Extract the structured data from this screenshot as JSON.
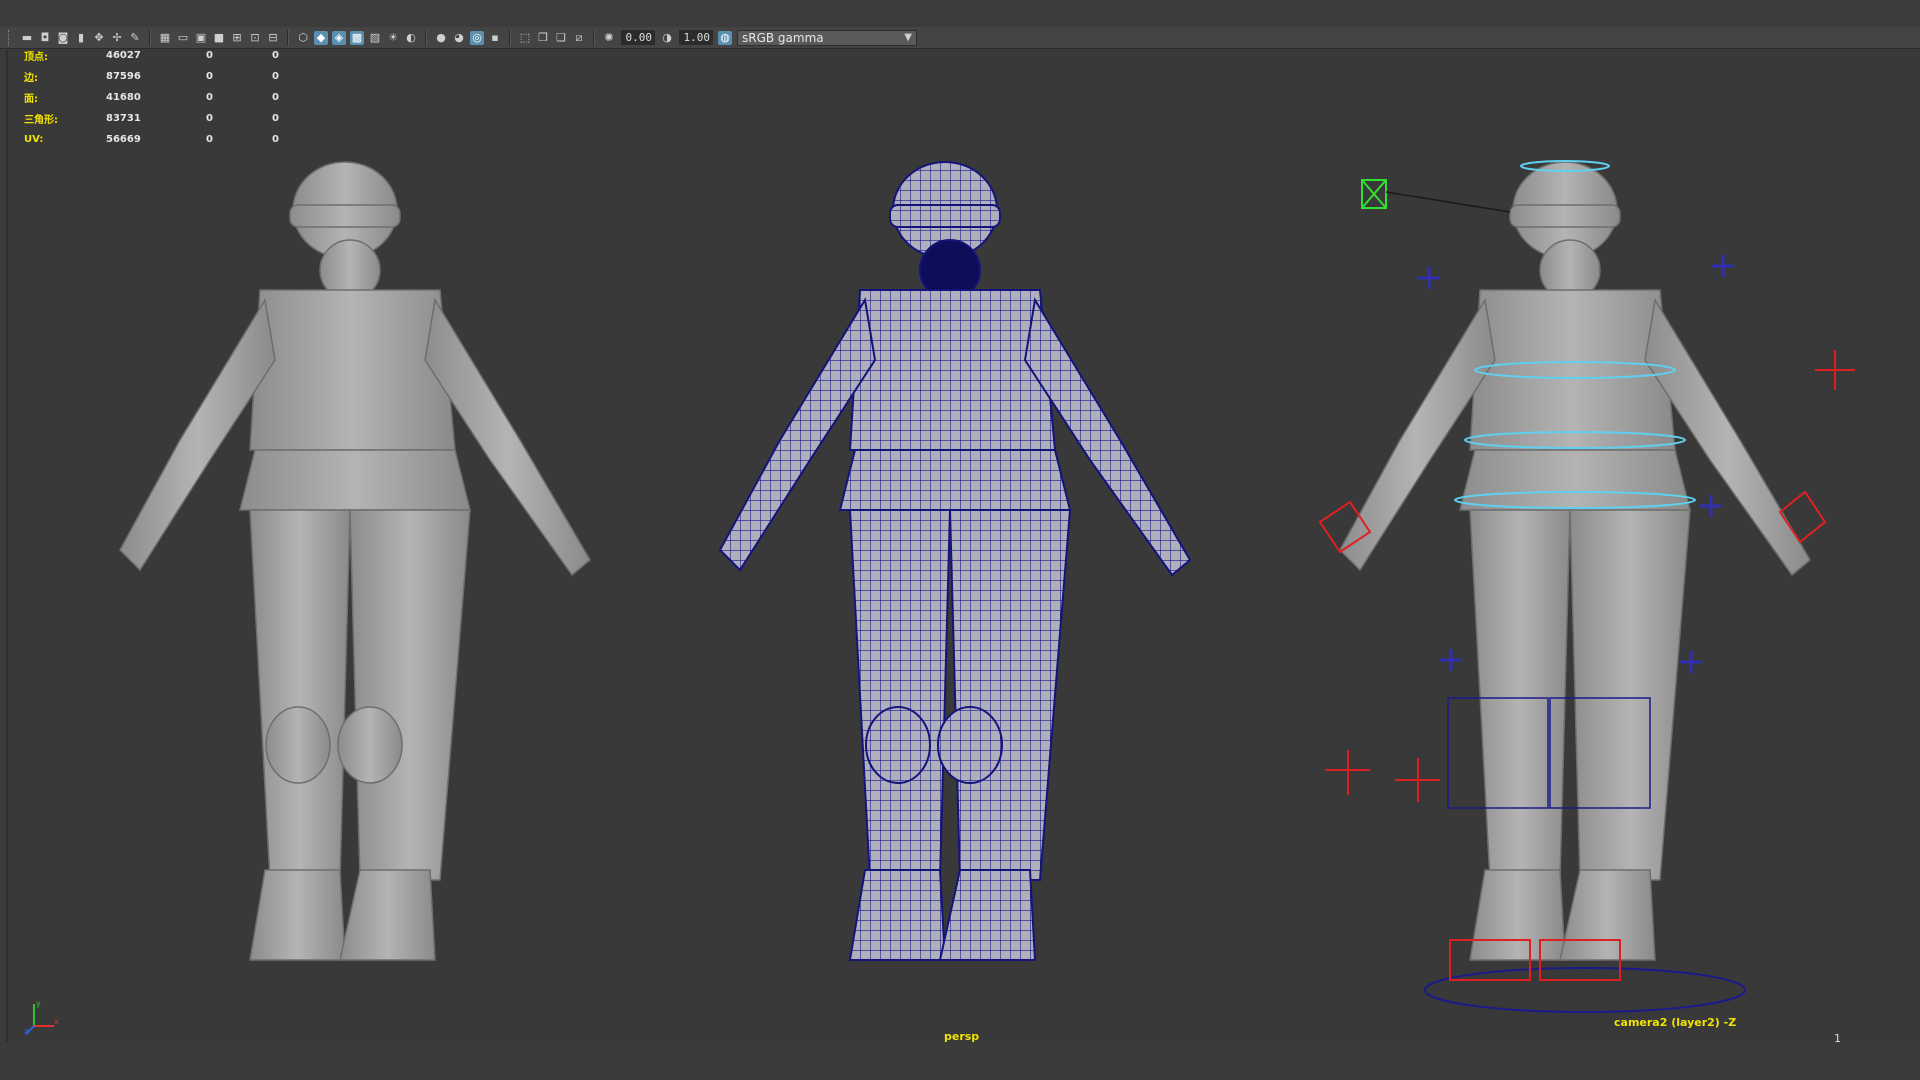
{
  "toolbar": {
    "exposure_value": "0.00",
    "gamma_value": "1.00",
    "color_space": "sRGB gamma",
    "icons": [
      "camera-icon",
      "camera-attr-icon",
      "bookmark-icon",
      "image-plane-icon",
      "grid-icon",
      "film-gate-icon",
      "resolution-gate-icon",
      "safe-action-icon",
      "wireframe-icon",
      "smooth-shade-icon",
      "textured-icon",
      "lights-icon",
      "shadows-icon",
      "xray-icon",
      "isolate-icon",
      "exposure-icon",
      "gamma-icon",
      "color-mgmt-icon"
    ]
  },
  "hud": {
    "rows": [
      {
        "label": "顶点:",
        "value": "46027",
        "sel": "0",
        "comp": "0"
      },
      {
        "label": "边:",
        "value": "87596",
        "sel": "0",
        "comp": "0"
      },
      {
        "label": "面:",
        "value": "41680",
        "sel": "0",
        "comp": "0"
      },
      {
        "label": "三角形:",
        "value": "83731",
        "sel": "0",
        "comp": "0"
      },
      {
        "label": "UV:",
        "value": "56669",
        "sel": "0",
        "comp": "0"
      }
    ]
  },
  "viewport": {
    "camera_label": "persp",
    "camera2_label": "camera2 (layer2) -Z",
    "frame_label": "1"
  },
  "axis": {
    "x": "x",
    "y": "y",
    "z": "z"
  },
  "colors": {
    "hud_label": "#f2e200",
    "wireframe": "#1a1a8c",
    "model": "#a8a8a8",
    "control_cyan": "#5fd0f0",
    "control_red": "#e02020"
  }
}
